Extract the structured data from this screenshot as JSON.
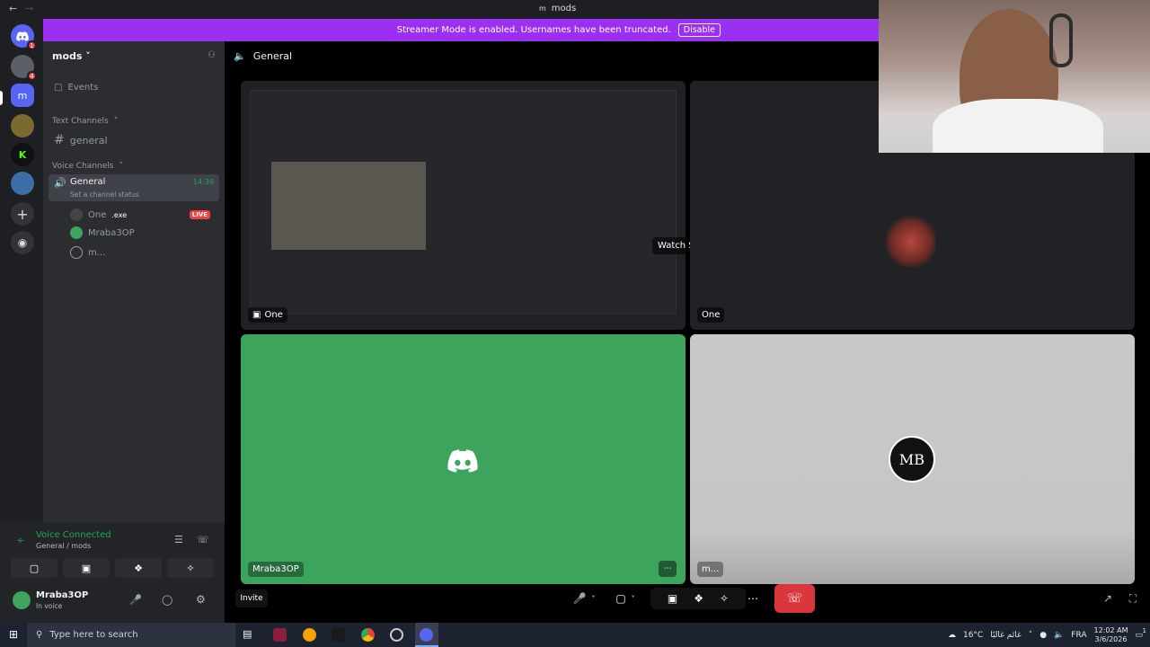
{
  "titlebar": {
    "title": "mods",
    "server_glyph": "m"
  },
  "banner": {
    "text": "Streamer Mode is enabled. Usernames have been truncated.",
    "disable_label": "Disable"
  },
  "rail": {
    "badges": [
      "1",
      "4"
    ]
  },
  "server": {
    "name": "mods"
  },
  "sidebar": {
    "events_label": "Events",
    "text_channels_label": "Text Channels",
    "text_channel": "general",
    "voice_channels_label": "Voice Channels",
    "voice_channel": "General",
    "voice_time": "14:39",
    "status_hint": "Set a channel status",
    "members": [
      {
        "name": "One",
        "tag": ".exe",
        "live": "LIVE"
      },
      {
        "name": "Mraba3OP"
      },
      {
        "name": "m..."
      }
    ]
  },
  "voice_panel": {
    "title": "Voice Connected",
    "subtitle": "General / mods"
  },
  "user": {
    "name": "Mraba3OP",
    "status": "In voice"
  },
  "main": {
    "channel": "General",
    "watch_stream": "Watch Stream",
    "tiles": [
      {
        "label": "One"
      },
      {
        "label": "One"
      },
      {
        "label": "Mraba3OP"
      },
      {
        "label": "m..."
      }
    ],
    "invite": "Invite"
  },
  "taskbar": {
    "search_placeholder": "Type here to search",
    "weather": "16°C",
    "weather_text": "غائم غالبًا",
    "lang": "FRA",
    "time": "12:02 AM",
    "date": "3/6/2026",
    "notif_count": "1"
  },
  "colors": {
    "accent": "#9b30f2",
    "discord_green": "#3ca45c",
    "danger": "#da373c",
    "voice_green": "#23a55a"
  }
}
